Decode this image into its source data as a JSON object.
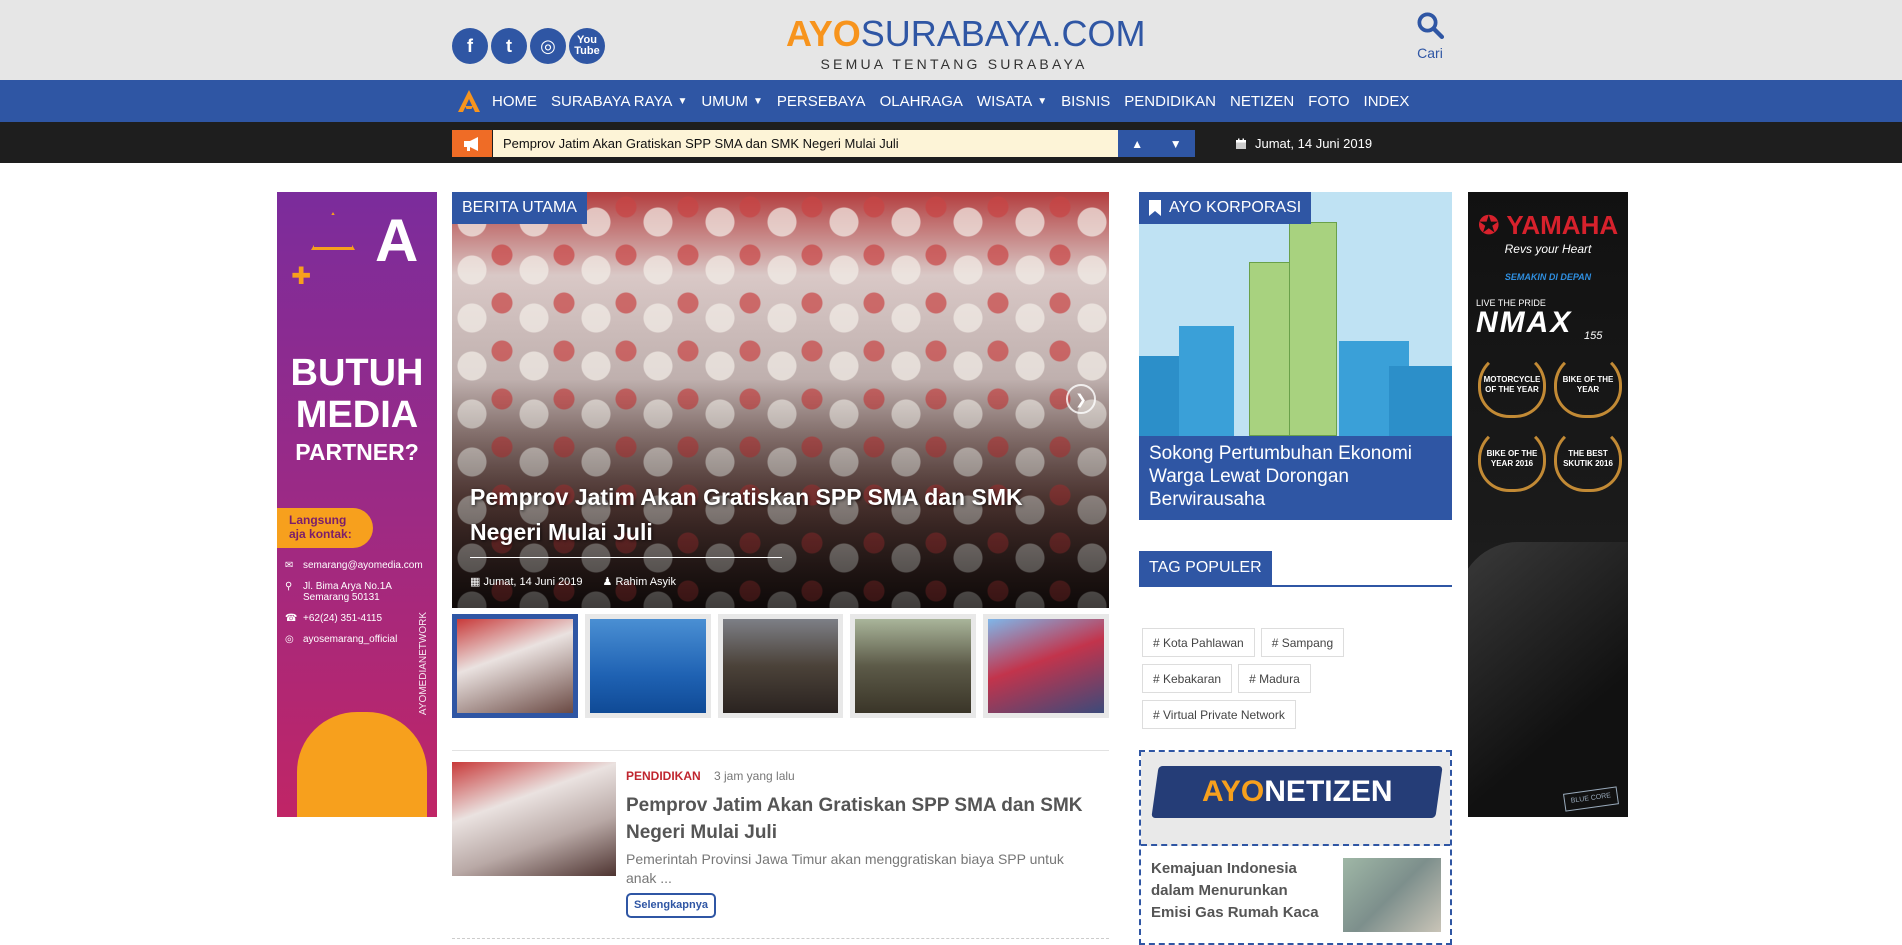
{
  "header": {
    "brand_ayo": "AYO",
    "brand_rest": "SURABAYA.COM",
    "tagline": "SEMUA TENTANG SURABAYA",
    "search_label": "Cari",
    "social": [
      {
        "icon": "facebook-icon",
        "glyph": "f"
      },
      {
        "icon": "twitter-icon",
        "glyph": "t"
      },
      {
        "icon": "instagram-icon",
        "glyph": "◎"
      },
      {
        "icon": "youtube-icon",
        "glyph": "You Tube"
      }
    ]
  },
  "nav": {
    "items": [
      {
        "label": "HOME",
        "dropdown": false
      },
      {
        "label": "SURABAYA RAYA",
        "dropdown": true
      },
      {
        "label": "UMUM",
        "dropdown": true
      },
      {
        "label": "PERSEBAYA",
        "dropdown": false
      },
      {
        "label": "OLAHRAGA",
        "dropdown": false
      },
      {
        "label": "WISATA",
        "dropdown": true
      },
      {
        "label": "BISNIS",
        "dropdown": false
      },
      {
        "label": "PENDIDIKAN",
        "dropdown": false
      },
      {
        "label": "NETIZEN",
        "dropdown": false
      },
      {
        "label": "FOTO",
        "dropdown": false
      },
      {
        "label": "INDEX",
        "dropdown": false
      }
    ]
  },
  "ticker": {
    "text": "Pemprov Jatim Akan Gratiskan SPP SMA dan SMK Negeri Mulai Juli",
    "date": "Jumat, 14 Juni 2019"
  },
  "ad_left": {
    "line1": "BUTUH",
    "line2": "MEDIA",
    "line3": "PARTNER?",
    "pill_line1": "Langsung",
    "pill_line2": "aja kontak:",
    "email": "semarang@ayomedia.com",
    "address1": "Jl. Bima Arya No.1A",
    "address2": "Semarang 50131",
    "phone": "+62(24) 351-4115",
    "instagram": "ayosemarang_official",
    "vertical": "AYOMEDIANETWORK"
  },
  "feature": {
    "section_label": "BERITA UTAMA",
    "headline": "Pemprov Jatim Akan Gratiskan SPP SMA dan SMK Negeri Mulai Juli",
    "date": "Jumat, 14 Juni 2019",
    "author": "Rahim Asyik",
    "thumbs": [
      {
        "bg": "linear-gradient(160deg,#c83a3a,#eae2e0 40%,#6b4a44)"
      },
      {
        "bg": "linear-gradient(180deg,#4a8fd3,#1f62b3 60%,#0f4a96)"
      },
      {
        "bg": "linear-gradient(180deg,#7d7f86,#4b4239 50%,#2a2320)"
      },
      {
        "bg": "linear-gradient(180deg,#a9b59a,#5c5a48 50%,#3a3528)"
      },
      {
        "bg": "linear-gradient(160deg,#7fb6e9,#c2344c 45%,#3c4a7a)"
      }
    ]
  },
  "news": {
    "category": "PENDIDIKAN",
    "time": "3 jam yang lalu",
    "title": "Pemprov Jatim Akan Gratiskan SPP SMA dan SMK Negeri Mulai Juli",
    "excerpt": "Pemerintah Provinsi Jawa Timur akan menggratiskan biaya SPP untuk anak ...",
    "more": "Selengkapnya"
  },
  "korporasi": {
    "section_label": "AYO KORPORASI",
    "caption": "Sokong Pertumbuhan Ekonomi Warga Lewat Dorongan Berwirausaha"
  },
  "tags": {
    "section_label": "TAG POPULER",
    "rows": [
      [
        "# Kota Pahlawan",
        "# Sampang"
      ],
      [
        "# Kebakaran",
        "# Madura"
      ],
      [
        "# Virtual Private Network"
      ]
    ]
  },
  "netizen": {
    "logo_a": "AYO",
    "logo_b": "NETIZEN",
    "title": "Kemajuan Indonesia dalam Menurunkan Emisi Gas Rumah Kaca"
  },
  "ad_right": {
    "brand": "YAMAHA",
    "revs": "Revs your Heart",
    "semakin": "SEMAKIN DI DEPAN",
    "live": "LIVE THE PRIDE",
    "model": "NMAX",
    "cc": "155",
    "awards": [
      "MOTORCYCLE OF THE YEAR",
      "BIKE OF THE YEAR",
      "BIKE OF THE YEAR 2016",
      "THE BEST SKUTIK 2016"
    ],
    "bluecore": "BLUE CORE"
  },
  "colors": {
    "primary": "#2f56a4",
    "accent": "#f7941d",
    "ticker_bg": "#1e1e1e",
    "category_red": "#c0262f"
  }
}
